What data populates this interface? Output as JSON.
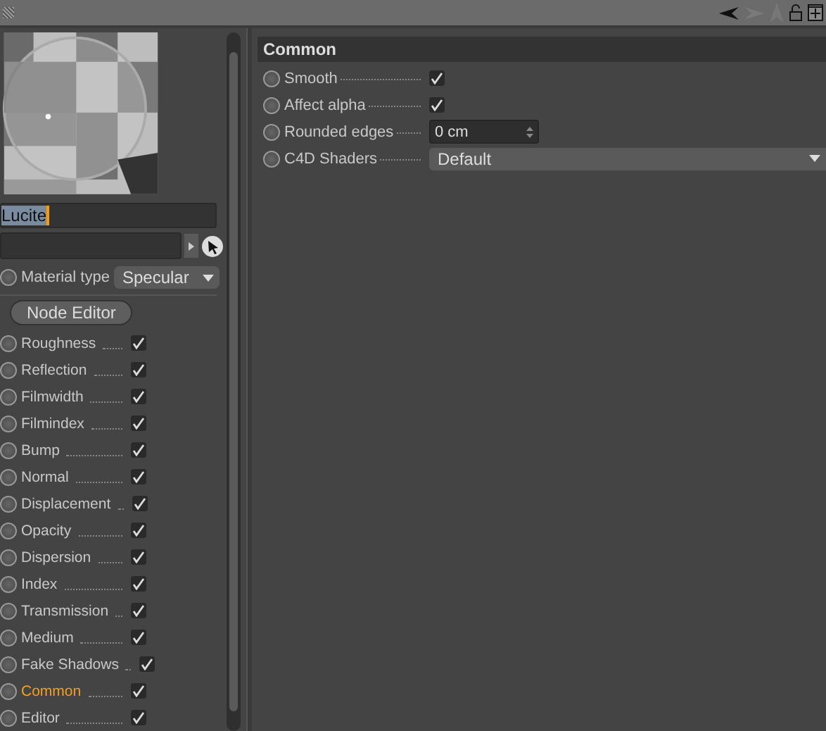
{
  "material": {
    "name": "Lucite"
  },
  "material_type": {
    "label": "Material type",
    "value": "Specular"
  },
  "node_editor": {
    "label": "Node Editor"
  },
  "channels": [
    {
      "label": "Roughness",
      "checked": true,
      "selected": false
    },
    {
      "label": "Reflection",
      "checked": true,
      "selected": false
    },
    {
      "label": "Filmwidth",
      "checked": true,
      "selected": false
    },
    {
      "label": "Filmindex",
      "checked": true,
      "selected": false
    },
    {
      "label": "Bump",
      "checked": true,
      "selected": false
    },
    {
      "label": "Normal",
      "checked": true,
      "selected": false
    },
    {
      "label": "Displacement",
      "checked": true,
      "selected": false
    },
    {
      "label": "Opacity",
      "checked": true,
      "selected": false
    },
    {
      "label": "Dispersion",
      "checked": true,
      "selected": false
    },
    {
      "label": "Index",
      "checked": true,
      "selected": false
    },
    {
      "label": "Transmission",
      "checked": true,
      "selected": false
    },
    {
      "label": "Medium",
      "checked": true,
      "selected": false
    },
    {
      "label": "Fake Shadows",
      "checked": true,
      "selected": false
    },
    {
      "label": "Common",
      "checked": true,
      "selected": true
    },
    {
      "label": "Editor",
      "checked": true,
      "selected": false
    }
  ],
  "section": {
    "title": "Common",
    "params": [
      {
        "kind": "checkbox",
        "label": "Smooth",
        "checked": true
      },
      {
        "kind": "checkbox",
        "label": "Affect alpha",
        "checked": true
      },
      {
        "kind": "number",
        "label": "Rounded edges",
        "value": "0 cm"
      },
      {
        "kind": "dropdown",
        "label": "C4D Shaders",
        "value": "Default"
      }
    ]
  }
}
